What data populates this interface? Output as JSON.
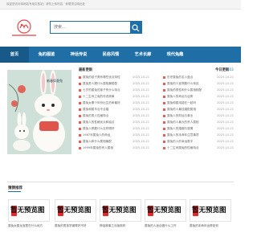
{
  "topbar": {
    "text": "欢迎您访问本网站专用文档站！请勿上传内容，转载须注明出处"
  },
  "search": {
    "placeholder": "搜索..."
  },
  "nav": [
    {
      "label": "首页",
      "active": true
    },
    {
      "label": "兔的图鉴",
      "active": false
    },
    {
      "label": "神话传说",
      "active": false
    },
    {
      "label": "民俗风情",
      "active": false
    },
    {
      "label": "艺术长廊",
      "active": false
    },
    {
      "label": "现代兔趣",
      "active": false
    }
  ],
  "hero": {
    "caption": "新春如意兔"
  },
  "left_panel": {
    "title": "最新更新",
    "items": [
      {
        "title": "属兔的孩子具有哪些优点特性",
        "date": "2025-10-21"
      },
      {
        "title": "属兔男人跟什么属相最般配",
        "date": "2025-10-21"
      },
      {
        "title": "七岁的属兔的孩子有什么特点",
        "date": "2025-10-21"
      },
      {
        "title": "十二生肖之兔的传说故事",
        "date": "2025-10-21"
      },
      {
        "title": "属兔女哪个年份出生的命最好",
        "date": "2025-10-21"
      },
      {
        "title": "属兔和属羊合不合婚",
        "date": "2025-10-21"
      },
      {
        "title": "属兔的男人性格特点",
        "date": "2025-10-21"
      },
      {
        "title": "属兔人的性格优点和缺点",
        "date": "2025-10-21"
      },
      {
        "title": "属兔人佩戴什么吉祥物好",
        "date": "2025-10-21"
      },
      {
        "title": "1987年属兔人的命运",
        "date": "2025-10-21"
      },
      {
        "title": "属兔人和什么属相最配",
        "date": "2025-10-21"
      },
      {
        "title": "1999年属兔的贵人属相",
        "date": "2025-10-21"
      }
    ]
  },
  "right_panel": {
    "title": "今日更新",
    "count": "103",
    "items": [
      {
        "title": "历史属兔的名人盘点",
        "date": "2025-10-21"
      },
      {
        "title": "属兔的人宜佩戴什么饰品",
        "date": "2025-10-21"
      },
      {
        "title": "属兔的男性和什么属相相配",
        "date": "2025-10-21"
      },
      {
        "title": "属兔人的命运与运势",
        "date": "2025-10-21"
      },
      {
        "title": "属兔和属鸡能在一起吗",
        "date": "2025-10-21"
      },
      {
        "title": "属兔的人最佳婚配属相",
        "date": "2025-10-21"
      },
      {
        "title": "属兔人的财运与事业",
        "date": "2025-10-21"
      },
      {
        "title": "属兔的人最大的贵人属相",
        "date": "2025-10-21"
      },
      {
        "title": "属兔人的婚姻与感情",
        "date": "2025-10-21"
      },
      {
        "title": "属兔人的本命年注意事项",
        "date": "2025-10-21"
      },
      {
        "title": "属兔的人的幸运数字",
        "date": "2025-10-21"
      },
      {
        "title": "十二生肖属兔的性格特点",
        "date": "2025-10-21"
      }
    ]
  },
  "section": {
    "title": "猜猜推荐"
  },
  "cards": [
    {
      "placeholder": "暂无预览图",
      "caption": "属兔女属龙宜居在什么地方"
    },
    {
      "placeholder": "暂无预览图",
      "caption": "属兔的男孩学钢琴好不好"
    },
    {
      "placeholder": "暂无预览图",
      "caption": "神话故事之月兔捣药"
    },
    {
      "placeholder": "暂无预览图",
      "caption": "属兔的人适合做什么工作"
    },
    {
      "placeholder": "暂无预览图",
      "caption": "属兔的本命年运势如何"
    }
  ],
  "colors": {
    "accent": "#1f6fa6",
    "bullet": "#e95a5a",
    "placeholder_red": "#e32b2b"
  }
}
